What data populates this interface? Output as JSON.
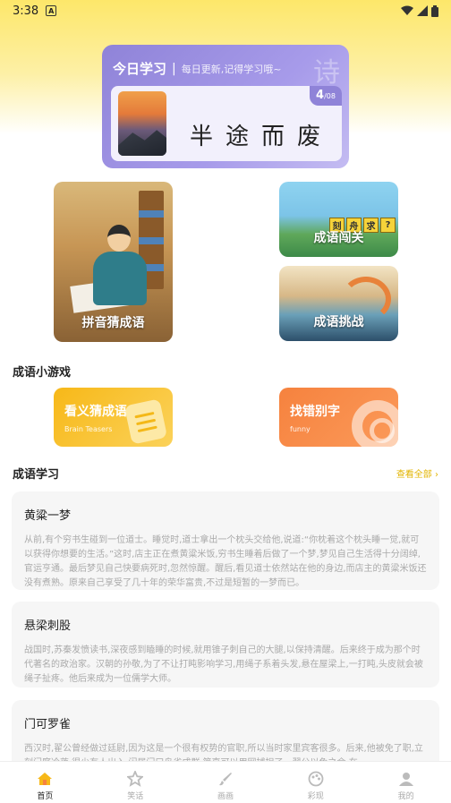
{
  "status": {
    "time": "3:38",
    "notif": "A"
  },
  "daily": {
    "title": "今日学习",
    "separator": "|",
    "subtitle": "每日更新,记得学习哦~",
    "deco": "诗",
    "badge_num": "4",
    "badge_total": "/08",
    "idiom": "半途而废"
  },
  "features": {
    "pinyin": "拼音猜成语",
    "chuangguan": "成语闯关",
    "chuangguan_tags": [
      "刻",
      "舟",
      "求",
      "?"
    ],
    "tiaozhan": "成语挑战"
  },
  "mini_games": {
    "section_title": "成语小游戏",
    "items": [
      {
        "title": "看义猜成语",
        "subtitle": "Brain Teasers"
      },
      {
        "title": "找错别字",
        "subtitle": "funny"
      }
    ]
  },
  "study": {
    "section_title": "成语学习",
    "see_all": "查看全部 ›",
    "items": [
      {
        "title": "黄粱一梦",
        "text": "从前,有个穷书生碰到一位道士。睡觉时,道士拿出一个枕头交给他,说道:“你枕着这个枕头睡一觉,就可以获得你想要的生活。”这时,店主正在煮黄粱米饭,穷书生睡着后做了一个梦,梦见自己生活得十分阔绰,官运亨通。最后梦见自己快要病死时,忽然惊醒。醒后,看见道士依然站在他的身边,而店主的黄粱米饭还没有煮熟。原来自己享受了几十年的荣华富贵,不过是短暂的一梦而已。"
      },
      {
        "title": "悬梁刺股",
        "text": "战国时,苏秦发愤读书,深夜感到瞌睡的时候,就用锥子刺自己的大腿,以保持清醒。后来终于成为那个时代著名的政治家。汉朝的孙敬,为了不让打盹影响学习,用绳子系着头发,悬在屋梁上,一打盹,头皮就会被绳子扯疼。他后来成为一位儒学大师。"
      },
      {
        "title": "门可罗雀",
        "text": "西汉时,翟公曾经做过廷尉,因为这是一个很有权势的官职,所以当时家里宾客很多。后来,他被免了职,立刻门庭冷落,很少有人出入,闲居门口鸟雀成群,简直可以用网捕捉了。翟公以免之余,在"
      }
    ]
  },
  "tabs": [
    {
      "label": "首页",
      "icon": "home-icon"
    },
    {
      "label": "笑话",
      "icon": "star-icon"
    },
    {
      "label": "画画",
      "icon": "brush-icon"
    },
    {
      "label": "彩现",
      "icon": "palette-icon"
    },
    {
      "label": "我的",
      "icon": "user-icon"
    }
  ],
  "colors": {
    "accent_purple": "#8f83d8",
    "accent_yellow": "#f7b818",
    "accent_orange": "#f6823e",
    "see_all": "#e2b400"
  }
}
